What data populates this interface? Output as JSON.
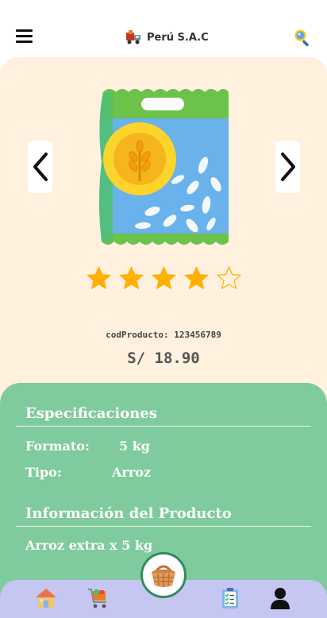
{
  "header": {
    "brand_name": "Perú S.A.C",
    "menu_icon": "hamburger-menu-icon",
    "search_icon": "search-icon",
    "logo_icon": "delivery-truck-logo-icon"
  },
  "product": {
    "image_icon": "rice-bag-image",
    "rating_value": 4,
    "rating_max": 5,
    "code_text": "codProducto: 123456789",
    "price_text": "S/ 18.90"
  },
  "specs": {
    "title": "Especificaciones",
    "rows": [
      {
        "label": "Formato:",
        "value": "5 kg"
      },
      {
        "label": "Tipo:",
        "value": "Arroz"
      }
    ],
    "info_title": "Información del Producto",
    "info_text": "Arroz extra x 5 kg"
  },
  "bottom_nav": {
    "items": [
      "home-icon",
      "shopping-cart-icon",
      "basket-icon",
      "clipboard-list-icon",
      "user-icon"
    ]
  },
  "colors": {
    "product_bg": "#fff1dd",
    "specs_bg": "#7fcb9d",
    "nav_bg": "#c6c6f2",
    "star": "#ffb000",
    "fab_border": "#2f8c5f"
  }
}
